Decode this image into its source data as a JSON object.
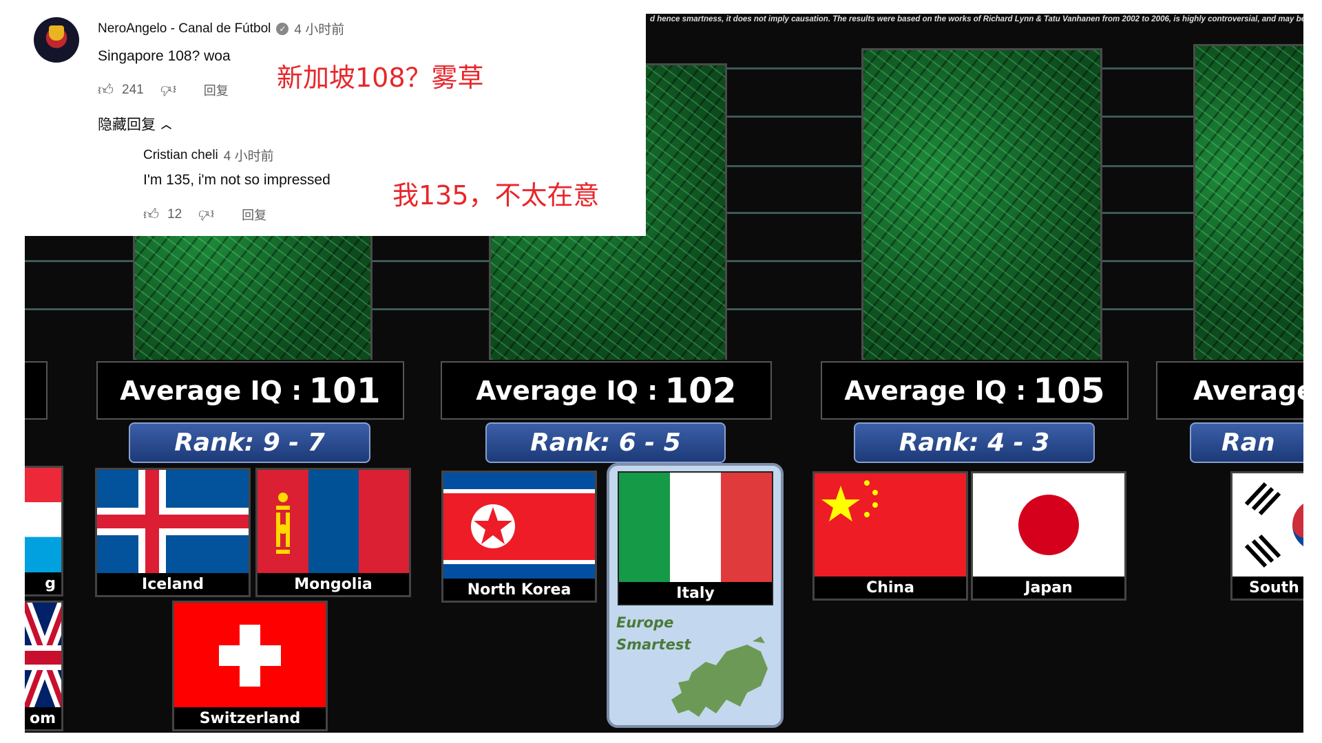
{
  "comments": [
    {
      "author": "NeroAngelo - Canal de Fútbol",
      "verified": true,
      "time": "4 小时前",
      "text": "Singapore 108? woa",
      "likes": "241",
      "reply_label": "回复",
      "annotation": "新加坡108？雾草"
    },
    {
      "author": "Cristian cheli",
      "time": "4 小时前",
      "text": "I'm 135, i'm not so impressed",
      "likes": "12",
      "reply_label": "回复",
      "annotation": "我135，不太在意"
    }
  ],
  "hide_replies_label": "隐藏回复",
  "video": {
    "disclaimer": "d hence smartness, it does not imply causation. The results were based on the works of Richard Lynn & Tatu Vanhanen from 2002 to 2006, is highly controversial, and may be outdated.",
    "groups": [
      {
        "iq_label": "Average IQ :",
        "iq": "101",
        "rank": "Rank: 9 - 7",
        "countries": [
          "Iceland",
          "Mongolia",
          "Switzerland"
        ]
      },
      {
        "iq_label": "Average IQ :",
        "iq": "102",
        "rank": "Rank: 6 - 5",
        "countries": [
          "North Korea",
          "Italy"
        ]
      },
      {
        "iq_label": "Average IQ :",
        "iq": "105",
        "rank": "Rank: 4 - 3",
        "countries": [
          "China",
          "Japan"
        ]
      },
      {
        "iq_label": "Average",
        "rank": "Ran",
        "countries": [
          "South"
        ]
      }
    ],
    "partial_left": [
      "g",
      "om"
    ],
    "italy_badge": {
      "line1": "Europe",
      "line2": "Smartest"
    }
  },
  "colors": {
    "annotation": "#e8262b",
    "bar_green": "#1e8a3a",
    "rank_blue": "#2b4c92"
  }
}
